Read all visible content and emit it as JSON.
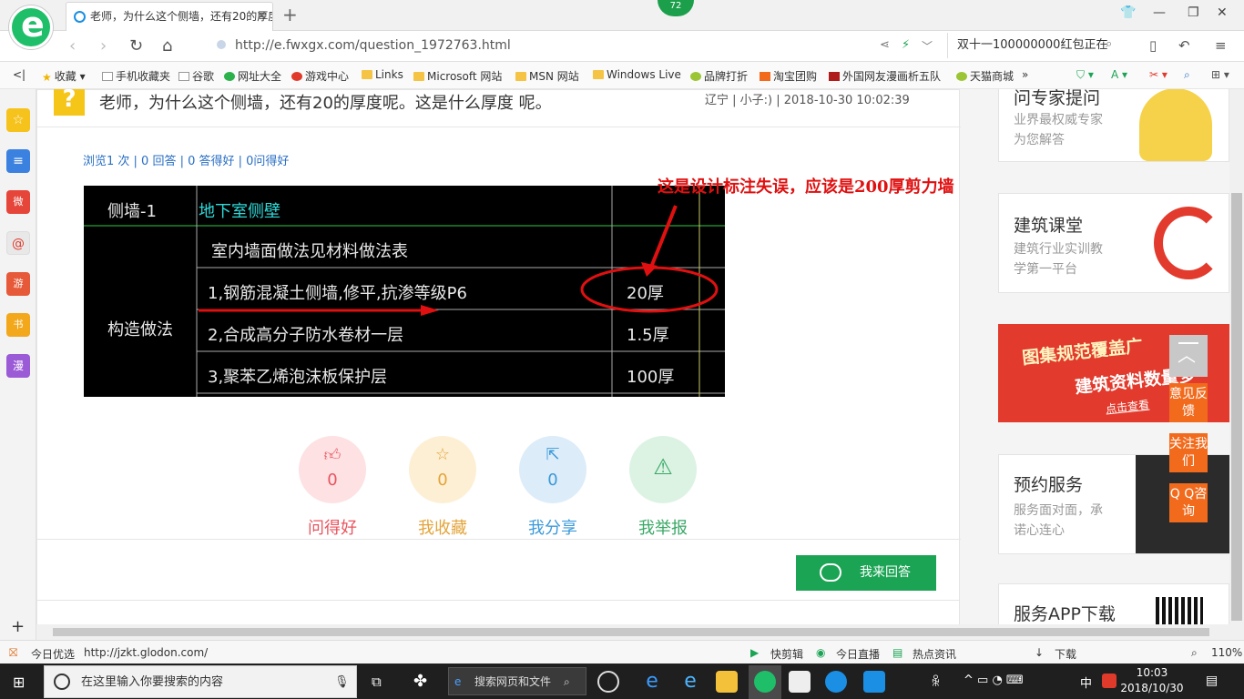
{
  "browser": {
    "tab_title": "老师，为什么这个侧墙，还有20的厚度呢。这是什么厚度 呢。",
    "new_tab": "+",
    "badge_count": "72",
    "url": "http://e.fwxgx.com/question_1972763.html",
    "search_text": "双十一100000000红包正在",
    "bookmarks": [
      "收藏",
      "手机收藏夹",
      "谷歌",
      "网址大全",
      "游戏中心",
      "Links",
      "Microsoft 网站",
      "MSN 网站",
      "Windows Live",
      "品牌打折",
      "淘宝团购",
      "外国网友漫画析五队",
      "天猫商城"
    ]
  },
  "sidebar": {
    "items": [
      "☆",
      "≡",
      "微",
      "@",
      "游",
      "书",
      "漫"
    ],
    "add": "+"
  },
  "question": {
    "title": "老师，为什么这个侧墙，还有20的厚度呢。这是什么厚度 呢。",
    "meta": "辽宁 | 小子:) | 2018-10-30 10:02:39",
    "stats": "浏览1 次 | 0 回答 | 0 答得好 | 0问得好",
    "annotation": "这是设计标注失误，应该是200厚剪力墙"
  },
  "cad": {
    "r1c1": "侧墙-1",
    "r1c2": "地下室侧壁",
    "r2c2": "室内墙面做法见材料做法表",
    "r3c2": "1,钢筋混凝土侧墙,修平,抗渗等级P6",
    "r3c3": "20厚",
    "r4c1": "构造做法",
    "r4c2": "2,合成高分子防水卷材一层",
    "r4c3": "1.5厚",
    "r5c2": "3,聚苯乙烯泡沫板保护层",
    "r5c3": "100厚"
  },
  "actions": [
    {
      "label": "问得好",
      "count": "0",
      "color": "#e8555f",
      "bg": "#fde1e3",
      "icon": "thumb-up-icon"
    },
    {
      "label": "我收藏",
      "count": "0",
      "color": "#e3a43a",
      "bg": "#fdefd4",
      "icon": "star-icon"
    },
    {
      "label": "我分享",
      "count": "0",
      "color": "#3b9ad9",
      "bg": "#dcecf9",
      "icon": "share-icon"
    },
    {
      "label": "我举报",
      "count": "0",
      "color": "#3aa866",
      "bg": "#dcf3e4",
      "icon": "warning-icon"
    }
  ],
  "answer_button": "我来回答",
  "right": {
    "expert": {
      "title": "问专家提问",
      "sub1": "业界最权威专家",
      "sub2": "为您解答"
    },
    "class": {
      "title": "建筑课堂",
      "sub1": "建筑行业实训教",
      "sub2": "学第一平台"
    },
    "promo": {
      "line1": "图集规范覆盖广",
      "line2": "建筑资料数量多",
      "link": "点击查看"
    },
    "booking": {
      "title": "预约服务",
      "sub1": "服务面对面，承",
      "sub2": "诺心连心"
    },
    "app": {
      "title": "服务APP下载"
    }
  },
  "float": {
    "feedback": "意见反馈",
    "follow": "关注我们",
    "qq": "Q Q咨询"
  },
  "status": {
    "left": "今日优选",
    "url": "http://jzkt.glodon.com/",
    "kuaijian": "快剪辑",
    "live": "今日直播",
    "news": "热点资讯",
    "download": "下载",
    "zoom": "110%"
  },
  "taskbar": {
    "search_placeholder": "在这里输入你要搜索的内容",
    "web_search": "搜索网页和文件",
    "ime": "中",
    "time": "10:03",
    "date": "2018/10/30"
  }
}
